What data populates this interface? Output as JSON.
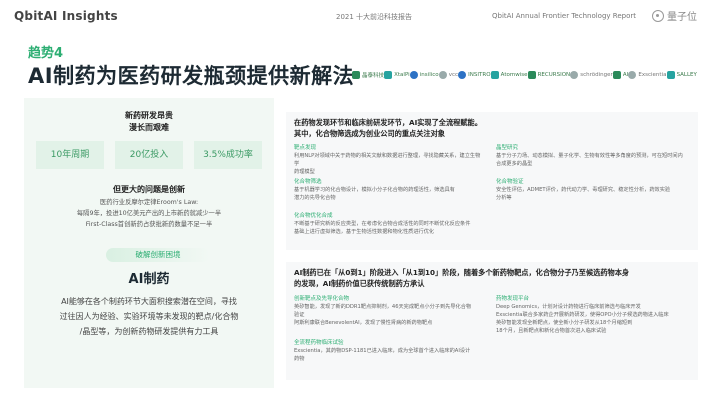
{
  "header": {
    "brand": "QbitAI Insights",
    "report_cn": "2021 十大前沿科技报告",
    "report_en": "QbitAI Annual Frontier Technology Report",
    "logo_text": "量子位"
  },
  "trend_label": "趋势4",
  "main_title": "AI制药为医药研发瓶颈提供新解法",
  "company_logos": [
    "晶泰科技",
    "XtalPi",
    "insilico",
    "vcc",
    "INSITRO",
    "Atomwise",
    "RECURSION",
    "schrödinger",
    "AI",
    "Exscientia",
    "SALLEY"
  ],
  "left_panel": {
    "heading_lines": [
      "新药研发昂贵",
      "漫长而艰难"
    ],
    "stats": [
      "10年周期",
      "20亿投入",
      "3.5%成功率"
    ],
    "innovation_heading": "但更大的问题是创新",
    "paragraph_lines": [
      "医药行业反摩尔定律Eroom's Law:",
      "每隔9年，投进10亿美元产出的上市新药就减少一半",
      "First-Class首创新药占获批新药数量不足一半"
    ],
    "pill_label": "破解创新困境",
    "ai_title": "AI制药",
    "ai_text_lines": [
      "AI能够在各个制药环节大面积搜索潜在空间，寻找",
      "过往因人为经验、实验环境等未发现的靶点/化合物",
      "/晶型等，为创新药物研发提供有力工具"
    ]
  },
  "right_top": {
    "heading_lines": [
      "在药物发现环节和临床前研发环节，AI实现了全流程赋能。",
      "其中，化合物筛选成为创业公司的重点关注对象"
    ],
    "items": [
      {
        "title": "靶点发现",
        "text": [
          "利用NLP对领域中关于药物的相关文献和数据进行整理，寻找隐藏关系，建立生物学",
          "药理模型"
        ]
      },
      {
        "title": "晶型研究",
        "text": [
          "基于分子力场、动态模拟、量子化学、生物有效性等多角度的预测，可在短时间内",
          "合成更多的晶型"
        ]
      },
      {
        "title": "化合物筛选",
        "text": [
          "基于机器学习的化合物设计，模拟小分子化合物的药理活性，筛选具有",
          "潜力的先导化合物"
        ]
      },
      {
        "title": "化合物验证",
        "text": [
          "安全性评估，ADMET评价，药代动力学、毒理研究、稳定性分析，药效实验",
          "分析等"
        ]
      },
      {
        "title": "化合物优化合成",
        "text": [
          "不断基于研究新的反应类型，在考虑化合物合成活性的同时不断优化反应条件",
          "基础上进行虚拟筛选，基于生物活性数据和物化性质进行优化"
        ]
      }
    ]
  },
  "right_bottom": {
    "heading_lines": [
      "AI制药已在「从0到1」阶段进入「从1到10」阶段，随着多个新药物靶点，化合物分子乃至候选药物本身",
      "的发现，AI制药价值已获传统制药方承认"
    ],
    "items": [
      {
        "title": "创新靶点及先导化合物",
        "text": [
          "英矽智能，发现了新的DDR1靶点抑制剂，46天完成靶点小分子到先导化合物",
          "验证",
          "阿斯利康联合BenevolentAI，发现了慢性肾病的新药物靶点"
        ]
      },
      {
        "title": "药物发现平台",
        "text": [
          "Deep Genomics，计划对设计药物进行临床前筛选与临床开发",
          "Exscientia联合多家药企开展新药研发，使得OPO小分子候选药物进入临床",
          "英矽智能发现全新靶点，使全新小分子研发从18个月缩短到",
          "18个月，且新靶点和新化合物首次进入临床试验"
        ]
      },
      {
        "title": "全流程药物临床试验",
        "text": [
          "Exscientia，其药物DSP-1181已进入临床，成为全球首个进入临床的AI设计",
          "药物"
        ]
      }
    ]
  }
}
